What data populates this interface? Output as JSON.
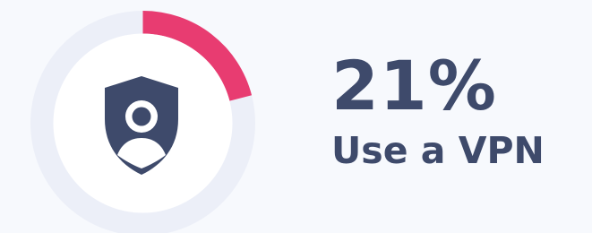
{
  "stat": {
    "value": "21%",
    "label": "Use a VPN",
    "fraction": 0.21
  },
  "icon": {
    "name": "shield-user-icon"
  },
  "colors": {
    "background": "#f7f9fd",
    "ring_track": "#eceff8",
    "ring_progress": "#e83c71",
    "inner_circle": "#ffffff",
    "icon": "#3e4a6b",
    "text": "#3e4a6b"
  }
}
